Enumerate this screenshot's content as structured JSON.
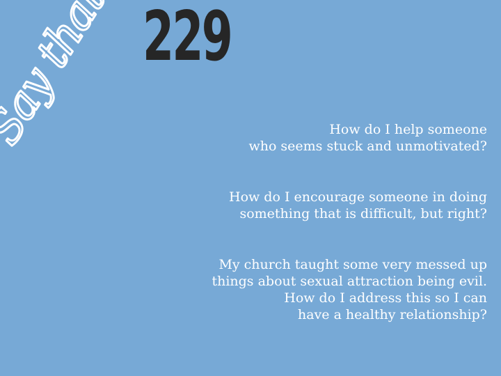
{
  "logo": {
    "text": "Say that.",
    "color": "#ffffff"
  },
  "episode": {
    "number": "229",
    "color": "#262626"
  },
  "background_color": "#77a9d6",
  "questions": [
    {
      "lines": [
        "How do I help someone",
        "who seems stuck and unmotivated?"
      ]
    },
    {
      "lines": [
        "How do I encourage someone in doing",
        "something that is difficult, but right?"
      ]
    },
    {
      "lines": [
        "My church taught some very messed up",
        "things about sexual attraction being evil.",
        "How do I address this so I can",
        "have a healthy relationship?"
      ]
    }
  ]
}
